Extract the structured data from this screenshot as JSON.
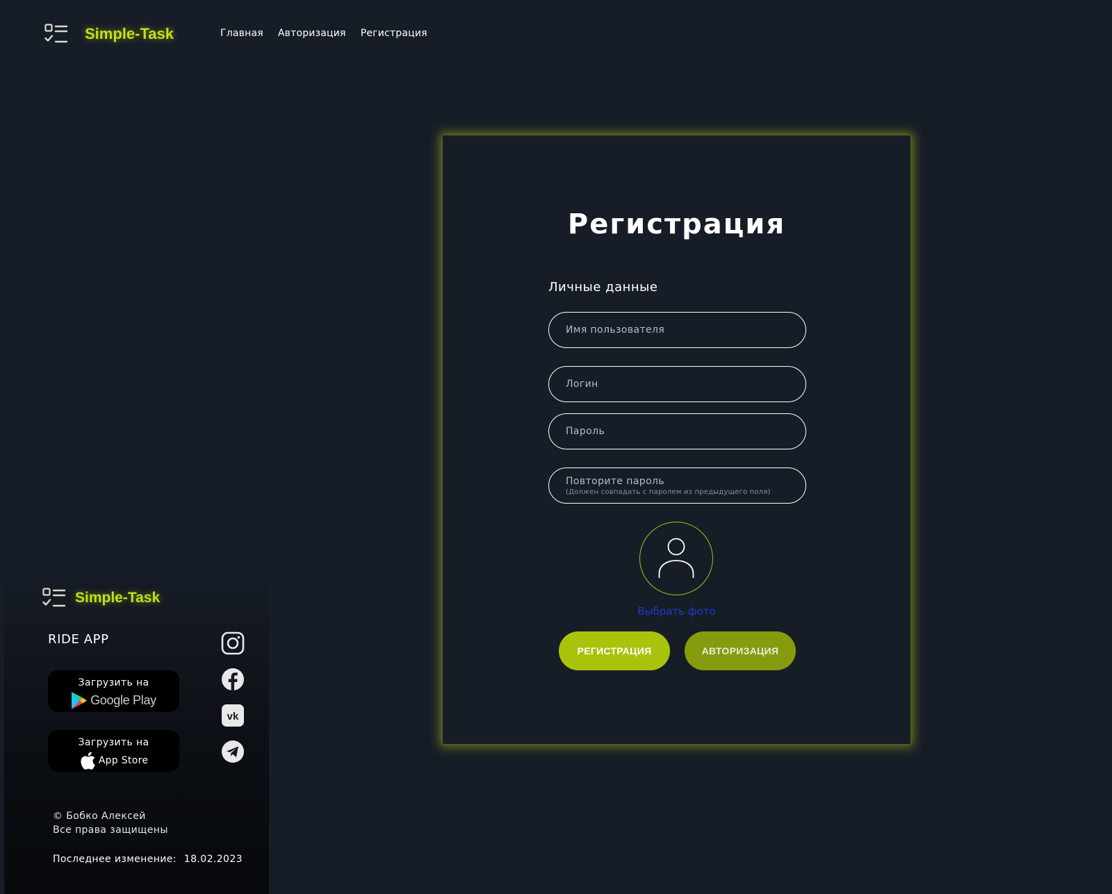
{
  "brand": {
    "name": "Simple-Task",
    "accent_color": "#c4e014"
  },
  "nav": {
    "items": [
      {
        "label": "Главная"
      },
      {
        "label": "Авторизация"
      },
      {
        "label": "Регистрация"
      }
    ]
  },
  "registration": {
    "title": "Регистрация",
    "section_label": "Личные данные",
    "fields": {
      "username": {
        "placeholder": "Имя пользователя",
        "value": ""
      },
      "login": {
        "placeholder": "Логин",
        "value": ""
      },
      "password": {
        "placeholder": "Пароль",
        "value": ""
      },
      "repeat_password": {
        "placeholder": "Повторите пароль",
        "hint": "(Должен совпадать с паролем из предыдущего поля)",
        "value": ""
      }
    },
    "avatar_icon": "user-icon",
    "choose_photo_label": "Выбрать фото",
    "register_button": "РЕГИСТРАЦИЯ",
    "login_button": "АВТОРИЗАЦИЯ"
  },
  "footer": {
    "brand_name": "Simple-Task",
    "ride_app": "RIDE APP",
    "google_play": {
      "top": "Загрузить на",
      "bottom": "Google Play"
    },
    "app_store": {
      "top": "Загрузить на",
      "bottom": "App Store"
    },
    "social": [
      {
        "icon": "instagram-icon"
      },
      {
        "icon": "facebook-icon"
      },
      {
        "icon": "vk-icon"
      },
      {
        "icon": "telegram-icon"
      }
    ],
    "copyright_line1": "© Бобко Алексей",
    "copyright_line2": "Все права защищены",
    "last_change_label": "Последнее изменение:",
    "last_change_date": "18.02.2023"
  }
}
